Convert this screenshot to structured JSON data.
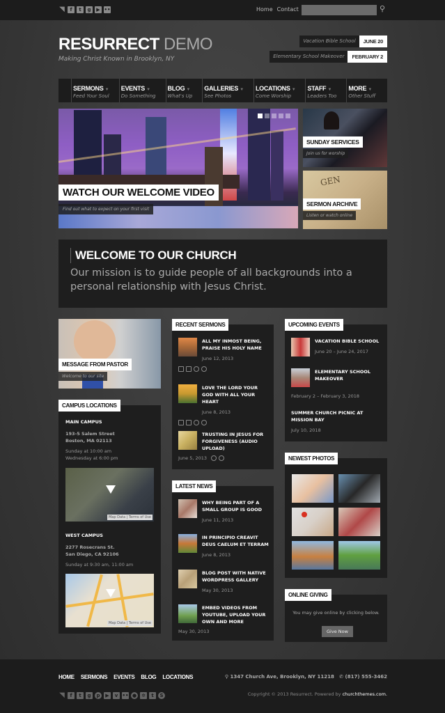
{
  "topbar": {
    "social_icons": [
      "rss-icon",
      "facebook-icon",
      "twitter-icon",
      "google-plus-icon",
      "youtube-icon",
      "flickr-icon"
    ],
    "links": [
      "Home",
      "Contact"
    ],
    "search_placeholder": "",
    "search_icon": "search-icon"
  },
  "header": {
    "logo_main": "RESURRECT",
    "logo_accent": "DEMO",
    "tagline": "Making Christ Known in Brooklyn, NY",
    "events": [
      {
        "name": "Vacation Bible School",
        "date": "JUNE 20"
      },
      {
        "name": "Elementary School Makeover",
        "date": "FEBRUARY 2"
      }
    ]
  },
  "nav": [
    {
      "label": "SERMONS",
      "sub": "Feed Your Soul"
    },
    {
      "label": "EVENTS",
      "sub": "Do Something"
    },
    {
      "label": "BLOG",
      "sub": "What's Up"
    },
    {
      "label": "GALLERIES",
      "sub": "See Photos"
    },
    {
      "label": "LOCATIONS",
      "sub": "Come Worship"
    },
    {
      "label": "STAFF",
      "sub": "Leaders Too"
    },
    {
      "label": "MORE",
      "sub": "Other Stuff"
    }
  ],
  "slider": {
    "title": "WATCH OUR WELCOME VIDEO",
    "subtitle": "Find out what to expect on your first visit",
    "slide_count": 5,
    "active_slide": 1
  },
  "side_boxes": [
    {
      "title": "SUNDAY SERVICES",
      "subtitle": "Join us for worship"
    },
    {
      "title": "SERMON ARCHIVE",
      "subtitle": "Listen or watch online"
    }
  ],
  "welcome": {
    "heading": "WELCOME TO OUR CHURCH",
    "text": "Our mission is to guide people of all backgrounds into a personal relationship with Jesus Christ."
  },
  "pastor": {
    "title": "MESSAGE FROM PASTOR",
    "subtitle": "Welcome to our site"
  },
  "campus": {
    "title": "CAMPUS LOCATIONS",
    "locations": [
      {
        "name": "MAIN CAMPUS",
        "addr1": "193-5 Salem Street",
        "addr2": "Boston, MA 02113",
        "times1": "Sunday at 10:00 am",
        "times2": "Wednesday at 6:00 pm",
        "map_credit1": "Map Data",
        "map_credit2": "Terms of Use"
      },
      {
        "name": "WEST CAMPUS",
        "addr1": "2277 Rosecrans St.",
        "addr2": "San Diego, CA 92106",
        "times1": "Sunday at 9:30 am, 11:00 am",
        "times2": "",
        "map_credit1": "Map Data",
        "map_credit2": "Terms of Use"
      }
    ]
  },
  "sermons": {
    "title": "RECENT SERMONS",
    "items": [
      {
        "title": "ALL MY INMOST BEING, PRAISE HIS HOLY NAME",
        "date": "June 12, 2013"
      },
      {
        "title": "LOVE THE LORD YOUR GOD WITH ALL YOUR HEART",
        "date": "June 8, 2013"
      },
      {
        "title": "TRUSTING IN JESUS FOR FORGIVENESS (AUDIO UPLOAD)",
        "date": "June 5, 2013"
      }
    ]
  },
  "news": {
    "title": "LATEST NEWS",
    "items": [
      {
        "title": "WHY BEING PART OF A SMALL GROUP IS GOOD",
        "date": "June 11, 2013"
      },
      {
        "title": "IN PRINCIPIO CREAVIT DEUS CAELUM ET TERRAM",
        "date": "June 8, 2013"
      },
      {
        "title": "BLOG POST WITH NATIVE WORDPRESS GALLERY",
        "date": "May 30, 2013"
      },
      {
        "title": "EMBED VIDEOS FROM YOUTUBE, UPLOAD YOUR OWN AND MORE",
        "date": "May 30, 2013"
      }
    ]
  },
  "events": {
    "title": "UPCOMING EVENTS",
    "items": [
      {
        "title": "VACATION BIBLE SCHOOL",
        "date": "June 20 – June 24, 2017"
      },
      {
        "title": "ELEMENTARY SCHOOL MAKEOVER",
        "date": "February 2 – February 3, 2018"
      },
      {
        "title": "SUMMER CHURCH PICNIC AT MISSION BAY",
        "date": "July 10, 2018"
      }
    ]
  },
  "photos": {
    "title": "NEWEST PHOTOS",
    "count": 6
  },
  "giving": {
    "title": "ONLINE GIVING",
    "text": "You may give online by clicking below.",
    "button": "Give Now"
  },
  "footer": {
    "nav": [
      "HOME",
      "SERMONS",
      "EVENTS",
      "BLOG",
      "LOCATIONS"
    ],
    "address": "1347 Church Ave, Brooklyn, NY 11218",
    "phone": "(817) 555-3462",
    "copyright": "Copyright © 2013 Resurrect. Powered by",
    "powered_link": "churchthemes.com.",
    "social_icons": [
      "rss-icon",
      "facebook-icon",
      "twitter-icon",
      "google-plus-icon",
      "pinterest-icon",
      "youtube-icon",
      "vimeo-icon",
      "flickr-icon",
      "github-icon",
      "dribbble-icon",
      "tumblr-icon",
      "skype-icon"
    ]
  }
}
